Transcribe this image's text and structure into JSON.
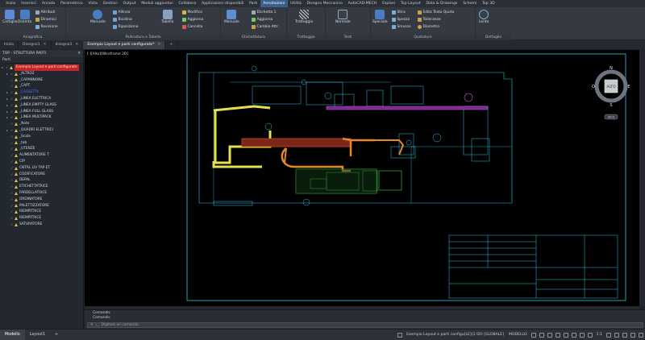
{
  "menubar": [
    "Inizio",
    "Inserisci",
    "Annota",
    "Parametrico",
    "Vista",
    "Gestisci",
    "Output",
    "Moduli aggiuntivi",
    "Collabora",
    "Applicazioni disponibili",
    "Parti",
    "Annotazioni",
    "Utilità",
    "Disegno Meccanico",
    "AutoCAD-MECH",
    "Esplosi",
    "Top Layout",
    "Data & Drawings",
    "Schemi",
    "Top 3D"
  ],
  "menubar_active": 11,
  "ribbon": {
    "panels": [
      {
        "title": "Anagrafica",
        "big": [
          "Cartiglio",
          "Distinta"
        ],
        "small": [
          "Attributi",
          "Dinamici",
          "Revisione"
        ]
      },
      {
        "title": "Pallinatura e Tabella",
        "big": [
          "Manuale"
        ],
        "small": [
          "Allinea",
          "Bicolina",
          "Riposiziona",
          "Tabella",
          "Modifica",
          "Aggiorna",
          "Cancella"
        ]
      },
      {
        "title": "Etichettatura",
        "big": [
          "Manuale"
        ],
        "small": [
          "Etichetta 1",
          "Aggiorna",
          "Cambia Attr."
        ]
      },
      {
        "title": "Tratteggio",
        "big": [
          "Tratteggio"
        ],
        "small": []
      },
      {
        "title": "Testi",
        "big": [
          "Normale"
        ],
        "small": []
      },
      {
        "title": "Quotature",
        "big": [
          "Speciale"
        ],
        "small": [
          "Stira",
          "Spezza",
          "Smusso",
          "Edita Testo Quota",
          "Tolleranze",
          "Diametro"
        ]
      },
      {
        "title": "Dettaglio",
        "big": [
          "Lente"
        ],
        "small": []
      }
    ]
  },
  "doctabs": [
    "Inizio",
    "Disegno1",
    "disegno1",
    "Esempio Layout e parti configurate*"
  ],
  "doctab_active": 3,
  "leftpanel": {
    "header": "TOP - STRUTTURA PARTI",
    "search": "Parti",
    "tree": [
      {
        "label": "Esempio Layout e parti configurate",
        "selected": true
      },
      {
        "label": "_ALTRO2"
      },
      {
        "label": "_CAPANNONE"
      },
      {
        "label": "_CAPT"
      },
      {
        "label": "_CASSETTA",
        "blue": true
      },
      {
        "label": "_LINEA ELETTRICA"
      },
      {
        "label": "_LINEA EMPTY GLASS"
      },
      {
        "label": "_LINEA FULL GLASS"
      },
      {
        "label": "_LINEA MULTIPACK"
      },
      {
        "label": "_Note"
      },
      {
        "label": "_QUADRI ELETTRICI"
      },
      {
        "label": "_Scala"
      },
      {
        "label": "_tab"
      },
      {
        "label": "_UTENZE"
      },
      {
        "label": "ALIMENTATORE T"
      },
      {
        "label": "CIP"
      },
      {
        "label": "CNTRL LIV TAP ET"
      },
      {
        "label": "CODIFICATORE"
      },
      {
        "label": "DEPAL"
      },
      {
        "label": "ETICHETTATRICE"
      },
      {
        "label": "FARDELLATRICE"
      },
      {
        "label": "ORDINATORE"
      },
      {
        "label": "PALETTIZZATORE"
      },
      {
        "label": "RIEMPITRICE"
      },
      {
        "label": "RIEMPITRICE"
      },
      {
        "label": "SATURATORE"
      }
    ]
  },
  "viewport": {
    "label": "[-][Alto][Wireframe 2D]",
    "viewcube_face": "ALTO",
    "compass": {
      "n": "N",
      "s": "S",
      "e": "E",
      "w": "O"
    },
    "wcs": "WCS"
  },
  "command": {
    "history": [
      "Comando:",
      "Comando:"
    ],
    "placeholder": "Digitare un comando"
  },
  "statusbar": {
    "tabs": [
      "Modello",
      "Layout1"
    ],
    "doc": "Esempio Layout e parti configu[LE](1:50) [GLOBALE]",
    "mode": "MODELLO",
    "scale": "1:1"
  },
  "colors": {
    "accent": "#3a5f8f",
    "drawing_cyan": "#2ec4e6",
    "yellow": "#e6e04a",
    "green": "#3ed44a",
    "red": "#e0452b",
    "orange": "#e58a2a",
    "magenta": "#d45ae6"
  }
}
